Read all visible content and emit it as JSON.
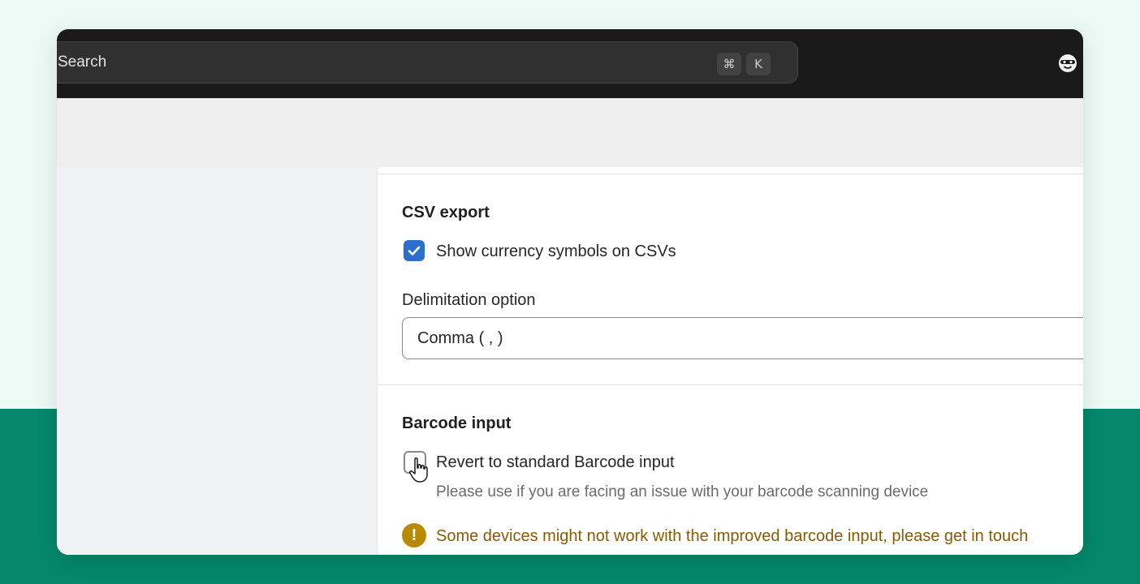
{
  "search": {
    "placeholder": "Search",
    "shortcut_cmd": "⌘",
    "shortcut_key": "K"
  },
  "csv_export": {
    "title": "CSV export",
    "currency_label": "Show currency symbols on CSVs",
    "currency_checked": true,
    "delimitation_label": "Delimitation option",
    "delimitation_value": "Comma ( , )"
  },
  "barcode_input": {
    "title": "Barcode input",
    "revert_label": "Revert to standard Barcode input",
    "revert_checked": false,
    "revert_help": "Please use if you are facing an issue with your barcode scanning device",
    "warning_text": "Some devices might not work with the improved barcode input, please get in touch"
  },
  "colors": {
    "page_bg_top": "#ecfaf6",
    "page_bg_bottom": "#04876a",
    "topbar": "#1a1a1a",
    "checkbox_accent": "#2c6ecb",
    "warning": "#b98900"
  },
  "icons": {
    "avatar": "avatar-face-icon",
    "checkmark": "checkmark-icon",
    "warning": "exclamation-circle-icon",
    "cursor": "hand-pointer-icon"
  }
}
